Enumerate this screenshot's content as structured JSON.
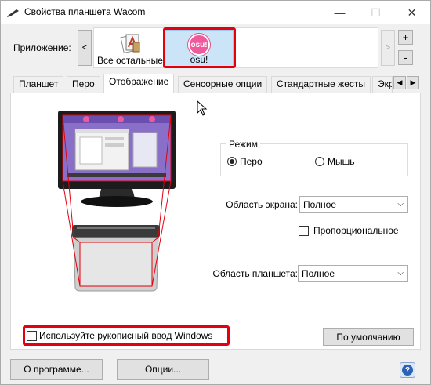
{
  "window": {
    "title": "Свойства планшета Wacom",
    "min_glyph": "—",
    "max_glyph": "☐",
    "close_glyph": "✕"
  },
  "apps": {
    "label": "Приложение:",
    "nav_left": "<",
    "nav_right": ">",
    "plus": "+",
    "minus": "-",
    "items": [
      {
        "label": "Все остальные",
        "icon": "all-apps-icon"
      },
      {
        "label": "osu!",
        "icon": "osu-icon",
        "badge": "osu!",
        "selected": true
      }
    ]
  },
  "tabs": {
    "items": [
      "Планшет",
      "Перо",
      "Отображение",
      "Сенсорные опции",
      "Стандартные жесты",
      "Экр"
    ],
    "active": "Отображение",
    "scroll_left": "◀",
    "scroll_right": "▶"
  },
  "mapping": {
    "mode": {
      "title": "Режим",
      "options": [
        {
          "label": "Перо",
          "checked": true
        },
        {
          "label": "Мышь",
          "checked": false
        }
      ]
    },
    "screen_area": {
      "label": "Область экрана:",
      "value": "Полное"
    },
    "proportional": {
      "label": "Пропорциональное",
      "checked": false
    },
    "tablet_area": {
      "label": "Область планшета:",
      "value": "Полное"
    },
    "windows_ink": {
      "label": "Используйте рукописный ввод Windows",
      "checked": false
    },
    "default_button": "По умолчанию"
  },
  "footer": {
    "about_button": "О программе...",
    "options_button": "Опции...",
    "help_glyph": "?"
  },
  "colors": {
    "highlight": "#e3000f",
    "osu_pink": "#ee5a9c",
    "selection_bg": "#cce4f7"
  }
}
